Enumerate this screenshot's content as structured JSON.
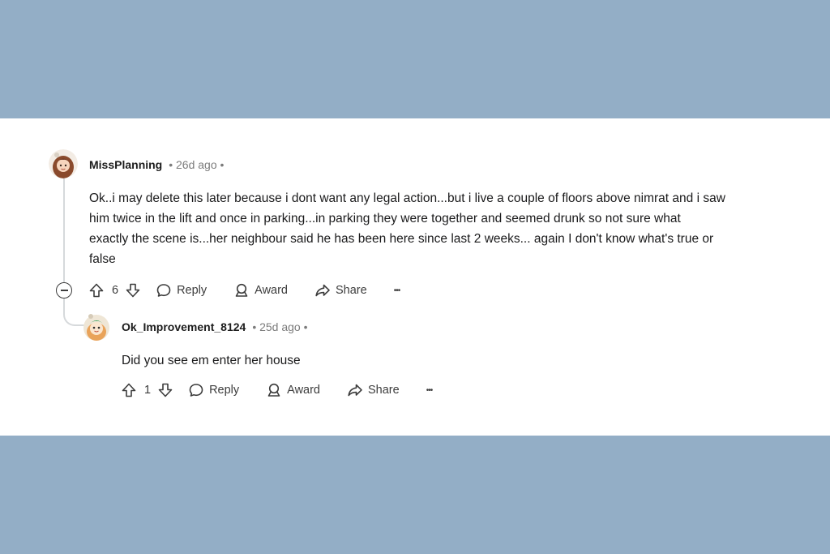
{
  "comments": [
    {
      "username": "MissPlanning",
      "meta": "• 26d ago •",
      "body_lines": [
        "Ok..i may delete this later because i dont want any legal action...but i live a couple of floors above nimrat and i saw",
        "him twice in the lift and once in parking...in parking they were together and seemed drunk so not sure what",
        "exactly the scene is...her neighbour said he has been here since last 2 weeks... again I don't know what's true or",
        "false"
      ],
      "votes": "6",
      "reply_label": "Reply",
      "award_label": "Award",
      "share_label": "Share",
      "more_label": "•••"
    },
    {
      "username": "Ok_Improvement_8124",
      "meta": "• 25d ago •",
      "body_lines": [
        "Did you see em enter her house"
      ],
      "votes": "1",
      "reply_label": "Reply",
      "award_label": "Award",
      "share_label": "Share",
      "more_label": "•••"
    }
  ],
  "colors": {
    "background": "#93aec6",
    "card": "#ffffff",
    "text": "#1a1a1b",
    "meta": "#7c7c7c",
    "thread_line": "#d6d9db"
  },
  "icons": [
    "upvote-icon",
    "downvote-icon",
    "reply-icon",
    "award-icon",
    "share-icon",
    "more-icon",
    "collapse-icon",
    "avatar"
  ]
}
